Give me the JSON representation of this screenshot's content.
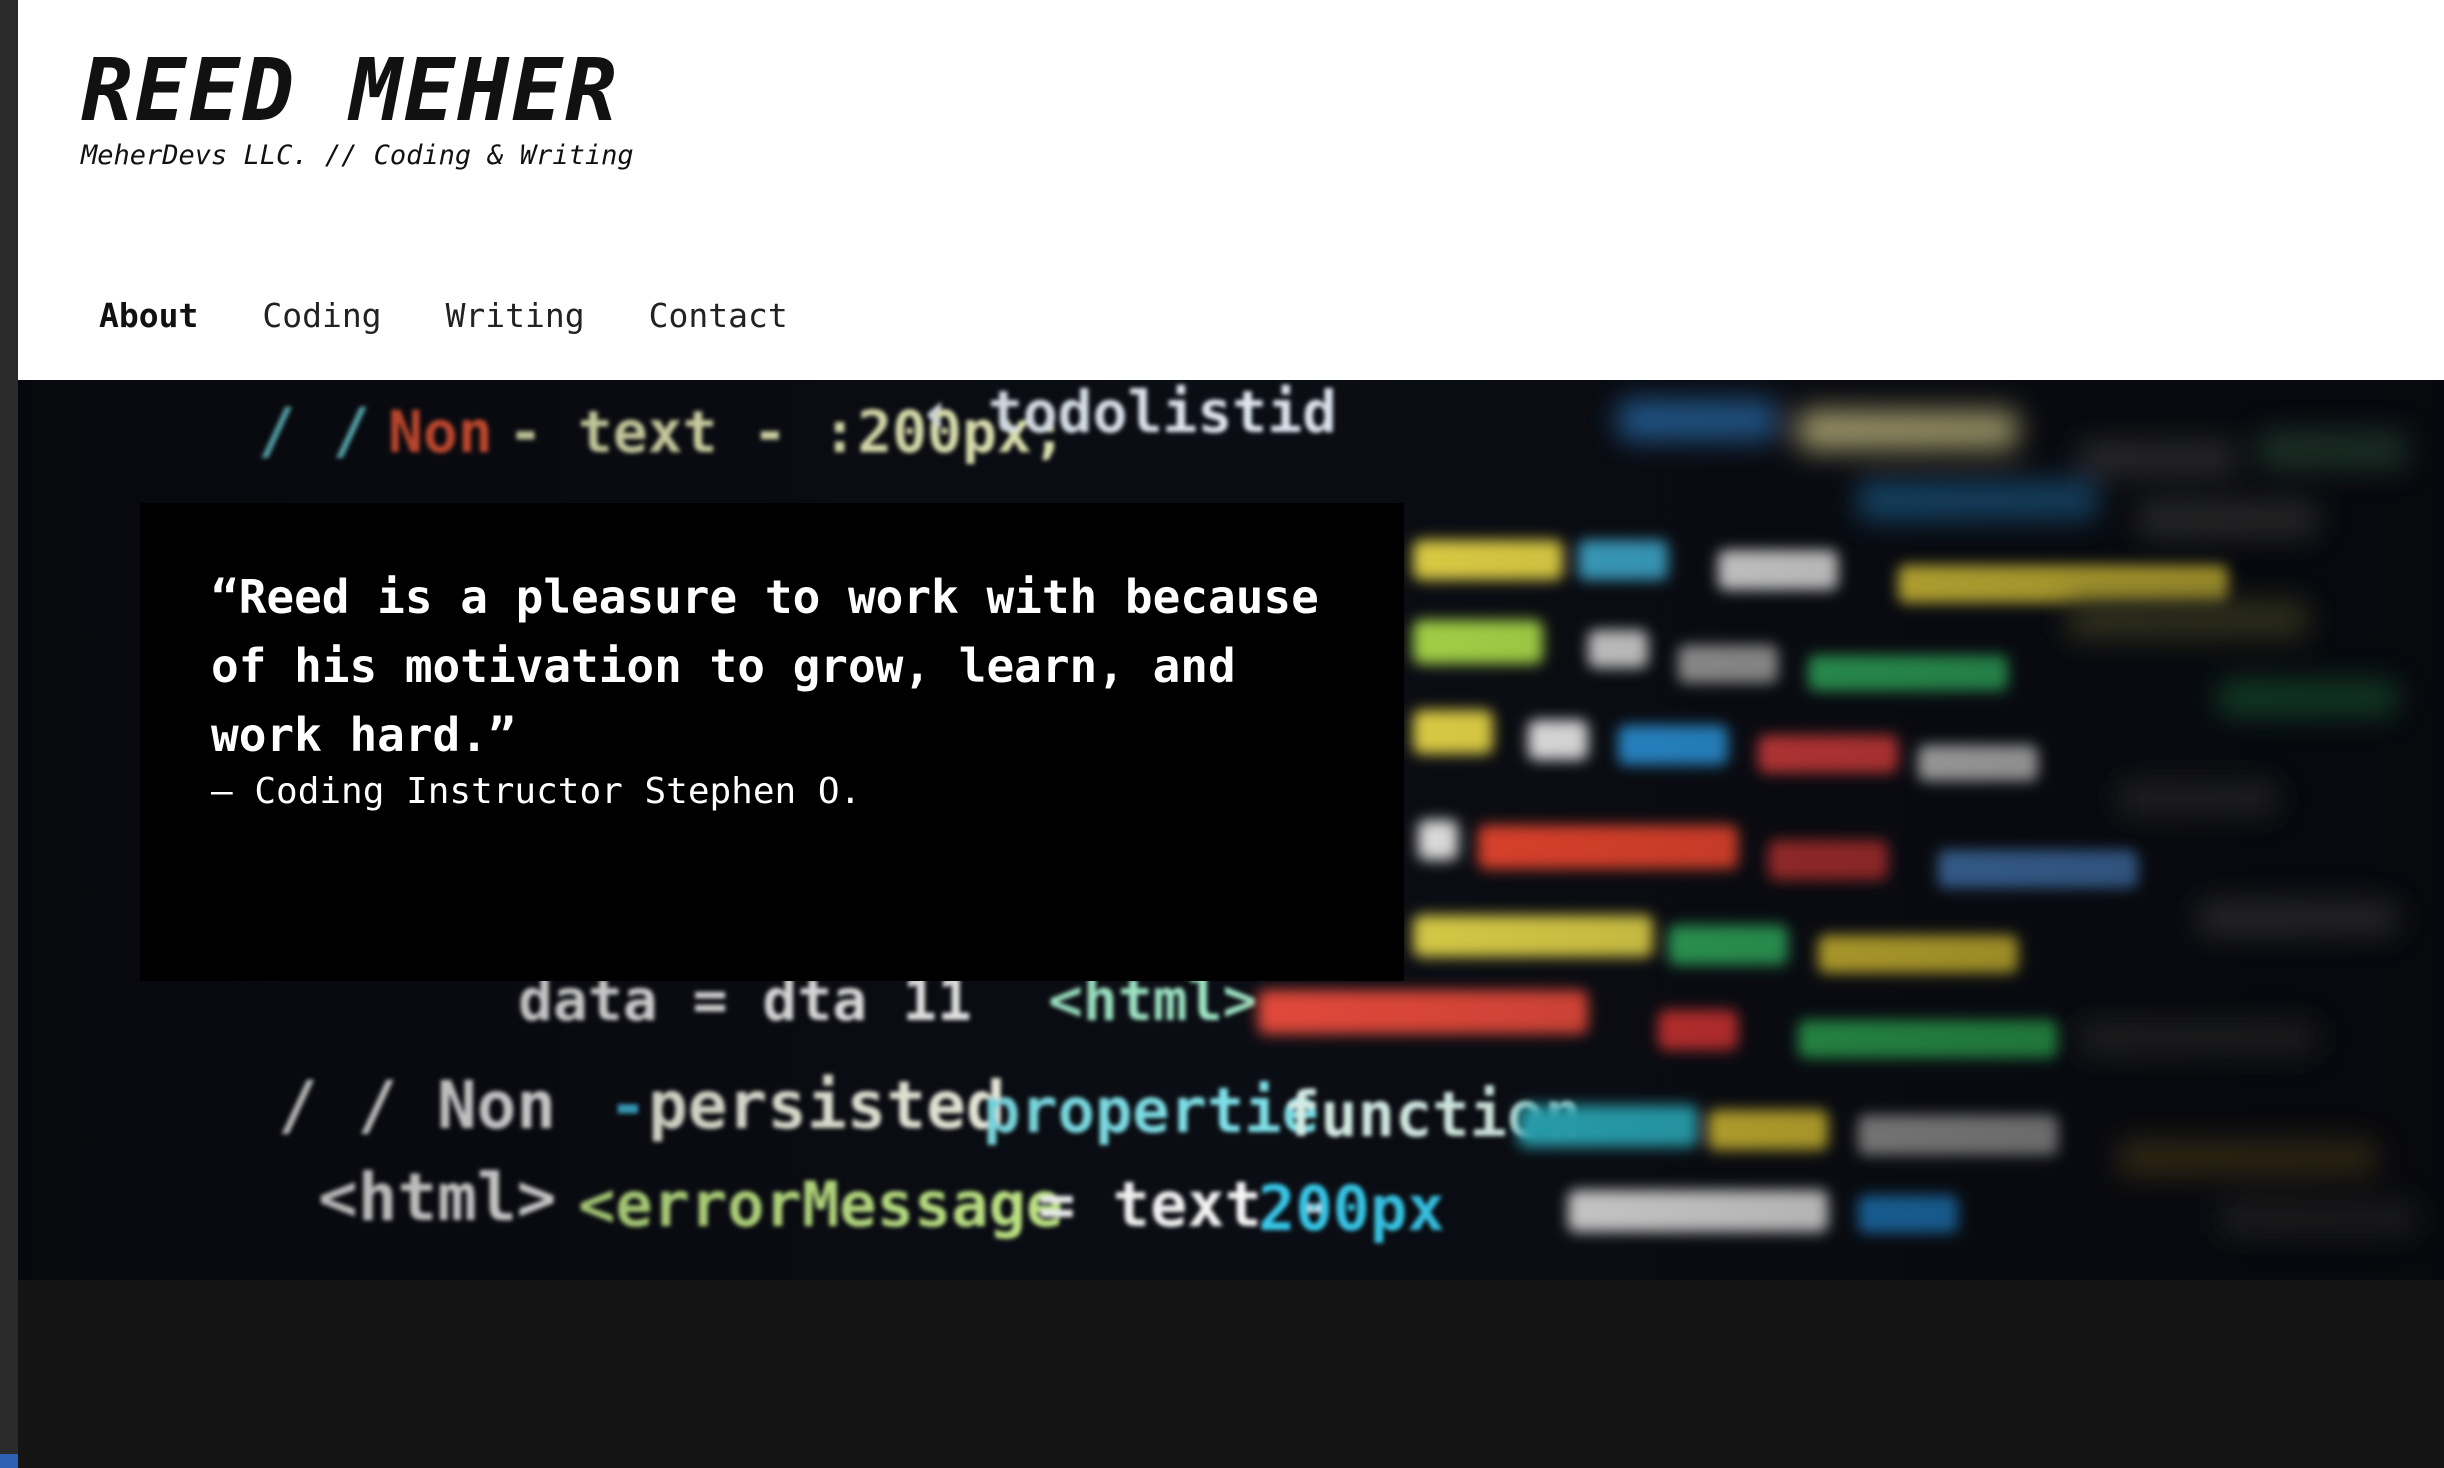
{
  "header": {
    "title": "REED MEHER",
    "tagline": "MeherDevs LLC. // Coding & Writing"
  },
  "nav": {
    "items": [
      {
        "label": "About",
        "active": true
      },
      {
        "label": "Coding",
        "active": false
      },
      {
        "label": "Writing",
        "active": false
      },
      {
        "label": "Contact",
        "active": false
      }
    ]
  },
  "hero": {
    "image": "blurred-code-editor-photo",
    "quote": "“Reed is a pleasure to work with because of his motivation to grow, learn, and work hard.”",
    "author": "– Coding Instructor Stephen O."
  },
  "colors": {
    "header_bg": "#ffffff",
    "page_bg": "#141414",
    "quote_bg": "#000000",
    "text_light": "#ffffff",
    "accent_strip": "#2d5fb4"
  }
}
